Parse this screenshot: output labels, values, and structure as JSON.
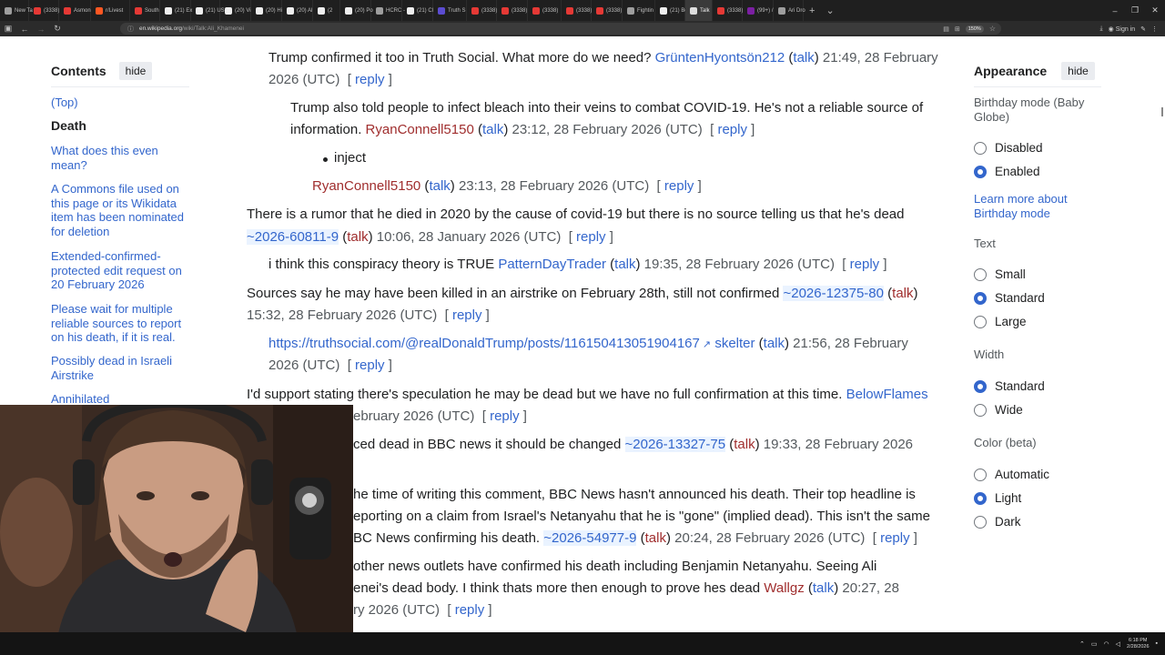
{
  "browser": {
    "tabs": [
      {
        "title": "New Ta",
        "color": "#9e9e9e"
      },
      {
        "title": "(3338)",
        "color": "#e53935"
      },
      {
        "title": "Asmon",
        "color": "#e53935"
      },
      {
        "title": "r/Livest",
        "color": "#ff5722"
      },
      {
        "title": "South",
        "color": "#e53935"
      },
      {
        "title": "(21) Ex",
        "color": "#eeeeee"
      },
      {
        "title": "(21) US",
        "color": "#eeeeee"
      },
      {
        "title": "(20) Vi",
        "color": "#eeeeee"
      },
      {
        "title": "(20) Hi",
        "color": "#eeeeee"
      },
      {
        "title": "(20) Al",
        "color": "#eeeeee"
      },
      {
        "title": "(2",
        "color": "#eeeeee"
      },
      {
        "title": "(20) Po",
        "color": "#eeeeee"
      },
      {
        "title": "HCRC -",
        "color": "#9e9e9e"
      },
      {
        "title": "(21) Cl",
        "color": "#eeeeee"
      },
      {
        "title": "Truth S",
        "color": "#5b4cd1"
      },
      {
        "title": "(3338)",
        "color": "#e53935"
      },
      {
        "title": "(3338)",
        "color": "#e53935"
      },
      {
        "title": "(3338)",
        "color": "#e53935"
      },
      {
        "title": "(3338)",
        "color": "#e53935"
      },
      {
        "title": "(3338)",
        "color": "#e53935"
      },
      {
        "title": "Fightin",
        "color": "#9e9e9e"
      },
      {
        "title": "(21) Bo",
        "color": "#eeeeee"
      },
      {
        "title": "Talk",
        "color": "#dddddd",
        "active": true
      },
      {
        "title": "(3338)",
        "color": "#e53935"
      },
      {
        "title": "(99+) /",
        "color": "#7b1fa2"
      },
      {
        "title": "Ari Dro",
        "color": "#9e9e9e"
      }
    ],
    "url_domain": "en.wikipedia.org",
    "url_path": "/wiki/Talk:Ali_Khamenei",
    "zoom": "150%",
    "sign_in": "Sign in"
  },
  "toc": {
    "title": "Contents",
    "hide": "hide",
    "items": [
      {
        "label": "(Top)",
        "current": false
      },
      {
        "label": "Death",
        "current": true
      },
      {
        "label": "What does this even mean?",
        "current": false
      },
      {
        "label": "A Commons file used on this page or its Wikidata item has been nominated for deletion",
        "current": false
      },
      {
        "label": "Extended-confirmed-protected edit request on 20 February 2026",
        "current": false
      },
      {
        "label": "Please wait for multiple reliable sources to report on his death, if it is real.",
        "current": false
      },
      {
        "label": "Possibly dead in Israeli Airstrike",
        "current": false
      },
      {
        "label": "Annihilated",
        "current": false
      }
    ]
  },
  "talk": {
    "c1_text": "Trump confirmed it too in Truth Social. What more do we need?",
    "c1_user": "GrüntenHyontsön212",
    "c1_ts1": " 21:49, 28 February",
    "c1_ts2": "2026 (UTC)",
    "c2_text1": "Trump also told people to infect bleach into their veins to combat COVID-19. He's not a reliable source of",
    "c2_text2": "information.",
    "c2_user": "RyanConnell5150",
    "c2_ts": " 23:12, 28 February 2026 (UTC)",
    "bullet": "inject",
    "c3_user": "RyanConnell5150",
    "c3_ts": " 23:13, 28 February 2026 (UTC)",
    "c4_text": "There is a rumor that he died in 2020 by the cause of covid-19 but there is no source telling us that he's dead",
    "c4_user": "~2026-60811-9",
    "c4_ts": " 10:06, 28 January 2026 (UTC)",
    "c5_text": "i think this conspiracy theory is TRUE",
    "c5_user": "PatternDayTrader",
    "c5_ts": " 19:35, 28 February 2026 (UTC)",
    "c6_text": "Sources say he may have been killed in an airstrike on February 28th, still not confirmed",
    "c6_user": "~2026-12375-80",
    "c6_ts": "15:32, 28 February 2026 (UTC)",
    "c7_link": "https://truthsocial.com/@realDonaldTrump/posts/116150413051904167",
    "c7_user": "skelter",
    "c7_ts1": " 21:56, 28 February",
    "c7_ts2": "2026 (UTC)",
    "c8_text": "I'd support stating there's speculation he may be dead but we have no full confirmation at this time.",
    "c8_user": "BelowFlames",
    "c8_ts": "ebruary 2026 (UTC)",
    "c9_text": "ced dead in BBC news it should be changed",
    "c9_user": "~2026-13327-75",
    "c9_ts": " 19:33, 28 February 2026",
    "c10_text1": "he time of writing this comment, BBC News hasn't announced his death. Their top headline is",
    "c10_text2": "eporting on a claim from Israel's Netanyahu that he is \"gone\" (implied dead). This isn't the same",
    "c10_text3": "BC News confirming his death.",
    "c10_user": "~2026-54977-9",
    "c10_ts": " 20:24, 28 February 2026 (UTC)",
    "c11_text1": "other news outlets have confirmed his death including Benjamin Netanyahu. Seeing Ali",
    "c11_text2": "enei's dead body. I think thats more then enough to prove hes dead",
    "c11_user": "Wallgz",
    "c11_ts1": " 20:27, 28",
    "c11_ts2": "ry 2026 (UTC)",
    "talk": "talk",
    "reply": "reply"
  },
  "appearance": {
    "title": "Appearance",
    "hide": "hide",
    "birthday_label": "Birthday mode (Baby Globe)",
    "birthday_options": [
      {
        "label": "Disabled",
        "selected": false
      },
      {
        "label": "Enabled",
        "selected": true
      }
    ],
    "learn_more": "Learn more about Birthday mode",
    "text_label": "Text",
    "text_options": [
      {
        "label": "Small",
        "selected": false
      },
      {
        "label": "Standard",
        "selected": true
      },
      {
        "label": "Large",
        "selected": false
      }
    ],
    "width_label": "Width",
    "width_options": [
      {
        "label": "Standard",
        "selected": true
      },
      {
        "label": "Wide",
        "selected": false
      }
    ],
    "color_label": "Color (beta)",
    "color_options": [
      {
        "label": "Automatic",
        "selected": false
      },
      {
        "label": "Light",
        "selected": true
      },
      {
        "label": "Dark",
        "selected": false
      }
    ]
  },
  "taskbar": {
    "time": "6:18 PM",
    "date": "2/28/2026"
  }
}
